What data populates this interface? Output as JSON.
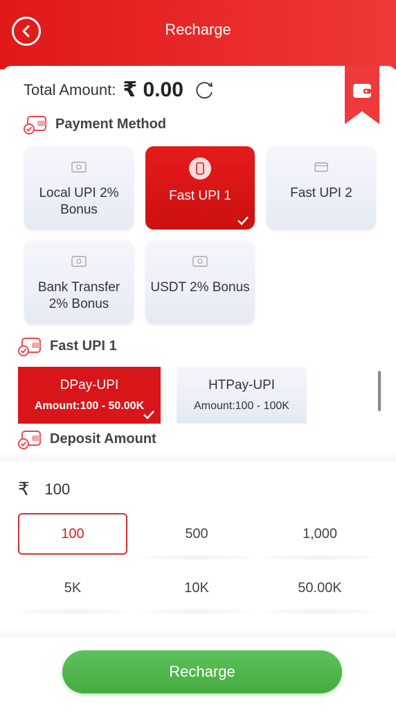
{
  "header": {
    "title": "Recharge"
  },
  "total": {
    "label": "Total Amount:",
    "amount": "₹ 0.00"
  },
  "sections": {
    "payment_method": "Payment Method",
    "channel": "Fast UPI 1",
    "deposit": "Deposit Amount"
  },
  "payment_methods": [
    {
      "label": "Local UPI 2% Bonus",
      "icon": "bank-card-icon",
      "selected": false
    },
    {
      "label": "Fast UPI 1",
      "icon": "phone-icon",
      "selected": true
    },
    {
      "label": "Fast UPI 2",
      "icon": "wallet-card-icon",
      "selected": false
    },
    {
      "label": "Bank Transfer 2% Bonus",
      "icon": "bank-card-icon",
      "selected": false
    },
    {
      "label": "USDT 2% Bonus",
      "icon": "crypto-card-icon",
      "selected": false
    }
  ],
  "channels": [
    {
      "name": "DPay-UPI",
      "range": "Amount:100 - 50.00K",
      "selected": true
    },
    {
      "name": "HTPay-UPI",
      "range": "Amount:100 - 100K",
      "selected": false
    }
  ],
  "deposit": {
    "currency": "₹",
    "value": "100"
  },
  "quick_amounts": [
    "100",
    "500",
    "1,000",
    "5K",
    "10K",
    "50.00K"
  ],
  "selected_quick_amount": "100",
  "recharge_button": "Recharge",
  "colors": {
    "brand_red": "#e01818",
    "recharge_green": "#4fb54a"
  }
}
